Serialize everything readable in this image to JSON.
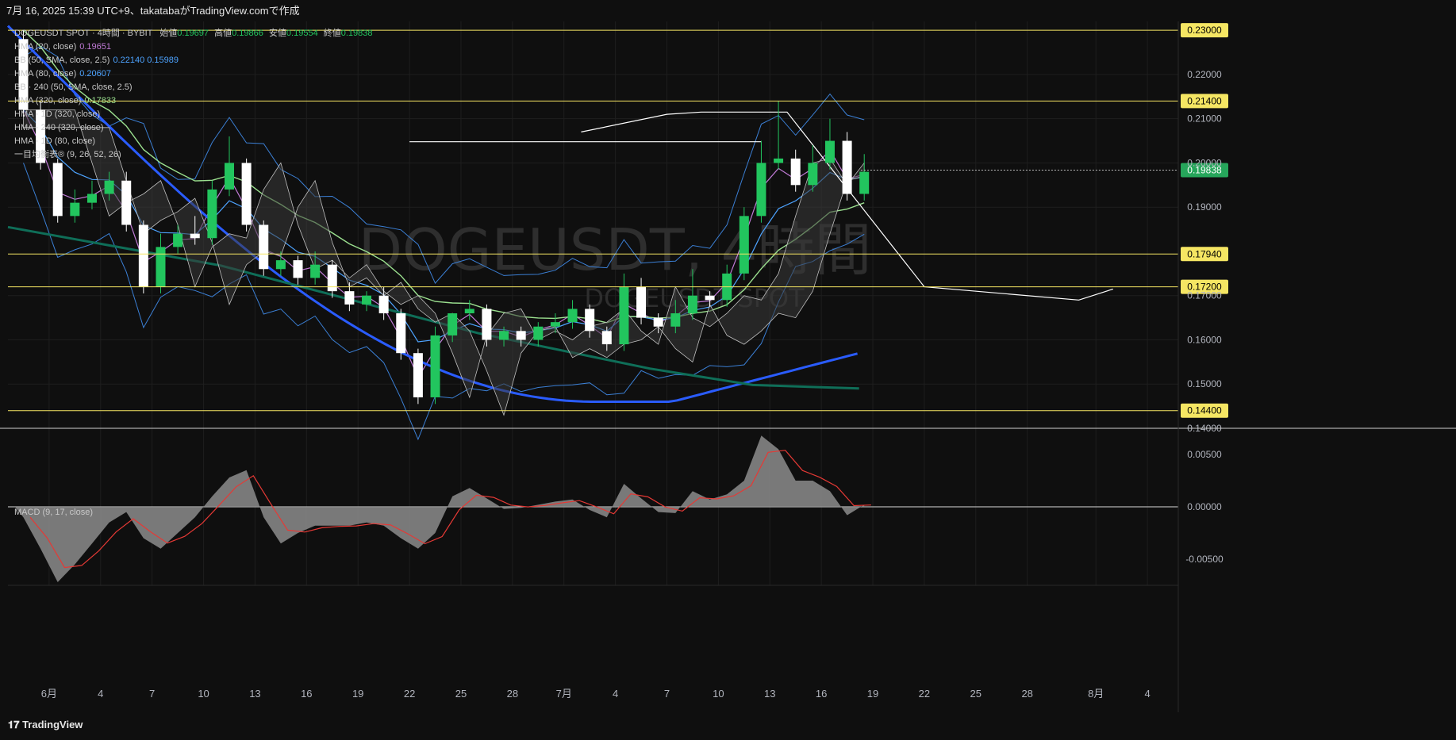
{
  "header": {
    "caption": "7月 16, 2025 15:39 UTC+9、takatabaがTradingView.comで作成"
  },
  "brand": {
    "logo_text": "TradingView"
  },
  "legend": {
    "main": {
      "symbol": "DOGEUSDT SPOT · 4時間 · BYBIT",
      "open_label": "始値",
      "open": "0.19697",
      "high_label": "高値",
      "high": "0.19866",
      "low_label": "安値",
      "low": "0.19554",
      "close_label": "終値",
      "close": "0.19838"
    },
    "rows": [
      {
        "label": "HMA (20, close)",
        "value": "0.19651",
        "color": "#c07ad6"
      },
      {
        "label": "BB (50, SMA, close, 2.5)",
        "value": "0.22140  0.15989",
        "color": "#4da3ff"
      },
      {
        "label": "HMA (80, close)",
        "value": "0.20607",
        "color": "#4da3ff"
      },
      {
        "label": "BB · 240 (50, SMA, close, 2.5)",
        "value": "",
        "color": "#c8c8c8"
      },
      {
        "label": "HMA (320, close)",
        "value": "0.17833",
        "color": "#9be08f"
      },
      {
        "label": "HMA · 1D (320, close)",
        "value": "",
        "color": "#c8c8c8"
      },
      {
        "label": "HMA · 240 (320, close)",
        "value": "",
        "color": "#c8c8c8"
      },
      {
        "label": "HMA · 1D (80, close)",
        "value": "",
        "color": "#c8c8c8"
      },
      {
        "label": "一目均衡表® (9, 26, 52, 26)",
        "value": "",
        "color": "#c8c8c8"
      }
    ]
  },
  "watermark": {
    "title": "DOGEUSDT, 4時間",
    "subtitle": "DOGEUSDT SPOT"
  },
  "macd": {
    "label": "MACD (9, 17, close)"
  },
  "colors": {
    "background": "#0f0f0f",
    "grid": "#1e1e1e",
    "up": "#22c55e",
    "down": "#ffffff",
    "hline": "#f5e663",
    "price_tag": "#f5e663",
    "last_price_tag": "#26a65b",
    "hma20": "#c07ad6",
    "hma80": "#4da3ff",
    "hma320": "#9be08f",
    "hma1d": "#2a5cff",
    "hma240_320": "#0f6e58",
    "bb": "#3b7fd4",
    "macd_hist": "#8c8c8c",
    "macd_signal": "#e53935"
  },
  "chart_data": [
    {
      "type": "candlestick",
      "title": "DOGEUSDT, 4時間",
      "ylim": [
        0.14,
        0.232
      ],
      "y_tick_labels": [
        "0.22000",
        "0.21000",
        "0.20000",
        "0.19000",
        "0.17000",
        "0.16000",
        "0.15000",
        "0.14000"
      ],
      "y_ticks": [
        0.22,
        0.21,
        0.2,
        0.19,
        0.17,
        0.16,
        0.15,
        0.14
      ],
      "horizontal_levels": [
        {
          "value": 0.23,
          "label": "0.23000"
        },
        {
          "value": 0.214,
          "label": "0.21400"
        },
        {
          "value": 0.1794,
          "label": "0.17940"
        },
        {
          "value": 0.172,
          "label": "0.17200"
        },
        {
          "value": 0.144,
          "label": "0.14400"
        }
      ],
      "last_price": {
        "value": 0.19838,
        "label": "0.19838"
      },
      "x_tick_labels": [
        "6月",
        "4",
        "7",
        "10",
        "13",
        "16",
        "19",
        "22",
        "25",
        "28",
        "7月",
        "4",
        "7",
        "10",
        "13",
        "16",
        "19",
        "22",
        "25",
        "28",
        "8月",
        "4"
      ],
      "x_days": [
        0,
        3,
        6,
        9,
        12,
        15,
        18,
        21,
        24,
        27,
        30,
        33,
        36,
        39,
        42,
        45,
        48,
        51,
        54,
        57,
        61,
        64
      ],
      "x_domain_days": [
        -2.4,
        65.8
      ],
      "candles_daily_approx": [
        {
          "day": -2,
          "o": 0.228,
          "h": 0.23,
          "c": 0.212
        },
        {
          "day": -1,
          "o": 0.212,
          "h": 0.214,
          "c": 0.2
        },
        {
          "day": 0,
          "o": 0.2,
          "h": 0.201,
          "c": 0.188
        },
        {
          "day": 1,
          "o": 0.188,
          "h": 0.194,
          "c": 0.191
        },
        {
          "day": 2,
          "o": 0.191,
          "h": 0.196,
          "c": 0.193
        },
        {
          "day": 3,
          "o": 0.193,
          "h": 0.198,
          "c": 0.196
        },
        {
          "day": 4,
          "o": 0.196,
          "h": 0.198,
          "c": 0.186
        },
        {
          "day": 5,
          "o": 0.186,
          "h": 0.187,
          "c": 0.172
        },
        {
          "day": 6,
          "o": 0.172,
          "h": 0.184,
          "c": 0.181
        },
        {
          "day": 7,
          "o": 0.181,
          "h": 0.186,
          "c": 0.184
        },
        {
          "day": 8,
          "o": 0.184,
          "h": 0.188,
          "c": 0.183
        },
        {
          "day": 9,
          "o": 0.183,
          "h": 0.196,
          "c": 0.194
        },
        {
          "day": 10,
          "o": 0.194,
          "h": 0.206,
          "c": 0.2
        },
        {
          "day": 11,
          "o": 0.2,
          "h": 0.201,
          "c": 0.186
        },
        {
          "day": 12,
          "o": 0.186,
          "h": 0.187,
          "c": 0.176
        },
        {
          "day": 13,
          "o": 0.176,
          "h": 0.18,
          "c": 0.178
        },
        {
          "day": 14,
          "o": 0.178,
          "h": 0.179,
          "c": 0.174
        },
        {
          "day": 15,
          "o": 0.174,
          "h": 0.18,
          "c": 0.177
        },
        {
          "day": 16,
          "o": 0.177,
          "h": 0.178,
          "c": 0.171
        },
        {
          "day": 17,
          "o": 0.171,
          "h": 0.173,
          "c": 0.168
        },
        {
          "day": 18,
          "o": 0.168,
          "h": 0.171,
          "c": 0.17
        },
        {
          "day": 19,
          "o": 0.17,
          "h": 0.172,
          "c": 0.166
        },
        {
          "day": 20,
          "o": 0.166,
          "h": 0.167,
          "c": 0.157
        },
        {
          "day": 21,
          "o": 0.157,
          "h": 0.158,
          "c": 0.147
        },
        {
          "day": 22,
          "o": 0.147,
          "h": 0.163,
          "c": 0.161
        },
        {
          "day": 23,
          "o": 0.161,
          "h": 0.166,
          "c": 0.166
        },
        {
          "day": 24,
          "o": 0.166,
          "h": 0.169,
          "c": 0.167
        },
        {
          "day": 25,
          "o": 0.167,
          "h": 0.168,
          "c": 0.16
        },
        {
          "day": 26,
          "o": 0.16,
          "h": 0.163,
          "c": 0.162
        },
        {
          "day": 27,
          "o": 0.162,
          "h": 0.163,
          "c": 0.16
        },
        {
          "day": 28,
          "o": 0.16,
          "h": 0.164,
          "c": 0.163
        },
        {
          "day": 29,
          "o": 0.163,
          "h": 0.166,
          "c": 0.164
        },
        {
          "day": 30,
          "o": 0.164,
          "h": 0.169,
          "c": 0.167
        },
        {
          "day": 31,
          "o": 0.167,
          "h": 0.168,
          "c": 0.162
        },
        {
          "day": 32,
          "o": 0.162,
          "h": 0.163,
          "c": 0.159
        },
        {
          "day": 33,
          "o": 0.159,
          "h": 0.175,
          "c": 0.172
        },
        {
          "day": 34,
          "o": 0.172,
          "h": 0.174,
          "c": 0.165
        },
        {
          "day": 35,
          "o": 0.165,
          "h": 0.166,
          "c": 0.163
        },
        {
          "day": 36,
          "o": 0.163,
          "h": 0.169,
          "c": 0.166
        },
        {
          "day": 37,
          "o": 0.166,
          "h": 0.176,
          "c": 0.17
        },
        {
          "day": 38,
          "o": 0.17,
          "h": 0.171,
          "c": 0.169
        },
        {
          "day": 39,
          "o": 0.169,
          "h": 0.177,
          "c": 0.175
        },
        {
          "day": 40,
          "o": 0.175,
          "h": 0.19,
          "c": 0.188
        },
        {
          "day": 41,
          "o": 0.188,
          "h": 0.205,
          "c": 0.2
        },
        {
          "day": 42,
          "o": 0.2,
          "h": 0.214,
          "c": 0.201
        },
        {
          "day": 43,
          "o": 0.201,
          "h": 0.203,
          "c": 0.195
        },
        {
          "day": 44,
          "o": 0.195,
          "h": 0.204,
          "c": 0.2
        },
        {
          "day": 45,
          "o": 0.2,
          "h": 0.21,
          "c": 0.205
        },
        {
          "day": 46,
          "o": 0.205,
          "h": 0.207,
          "c": 0.193
        },
        {
          "day": 47,
          "o": 0.193,
          "h": 0.202,
          "c": 0.198
        }
      ]
    },
    {
      "type": "macd",
      "title": "MACD (9, 17, close)",
      "ylim": [
        -0.0075,
        0.0075
      ],
      "y_tick_labels": [
        "0.00500",
        "0.00000",
        "-0.00500"
      ],
      "y_ticks": [
        0.005,
        0.0,
        -0.005
      ],
      "histogram_daily_approx": [
        {
          "day": -2,
          "v": -0.001
        },
        {
          "day": -1,
          "v": -0.004
        },
        {
          "day": 0,
          "v": -0.0072
        },
        {
          "day": 1,
          "v": -0.0055
        },
        {
          "day": 2,
          "v": -0.0035
        },
        {
          "day": 3,
          "v": -0.0015
        },
        {
          "day": 4,
          "v": -0.0005
        },
        {
          "day": 5,
          "v": -0.003
        },
        {
          "day": 6,
          "v": -0.004
        },
        {
          "day": 7,
          "v": -0.0025
        },
        {
          "day": 8,
          "v": -0.001
        },
        {
          "day": 9,
          "v": 0.001
        },
        {
          "day": 10,
          "v": 0.0028
        },
        {
          "day": 11,
          "v": 0.0035
        },
        {
          "day": 12,
          "v": -0.001
        },
        {
          "day": 13,
          "v": -0.0035
        },
        {
          "day": 14,
          "v": -0.0025
        },
        {
          "day": 15,
          "v": -0.0018
        },
        {
          "day": 16,
          "v": -0.0018
        },
        {
          "day": 17,
          "v": -0.0018
        },
        {
          "day": 18,
          "v": -0.0015
        },
        {
          "day": 19,
          "v": -0.0018
        },
        {
          "day": 20,
          "v": -0.003
        },
        {
          "day": 21,
          "v": -0.004
        },
        {
          "day": 22,
          "v": -0.0025
        },
        {
          "day": 23,
          "v": 0.001
        },
        {
          "day": 24,
          "v": 0.0018
        },
        {
          "day": 25,
          "v": 0.0008
        },
        {
          "day": 26,
          "v": -0.0002
        },
        {
          "day": 27,
          "v": -0.0001
        },
        {
          "day": 28,
          "v": 0.0002
        },
        {
          "day": 29,
          "v": 0.0005
        },
        {
          "day": 30,
          "v": 0.0007
        },
        {
          "day": 31,
          "v": -0.0003
        },
        {
          "day": 32,
          "v": -0.001
        },
        {
          "day": 33,
          "v": 0.0022
        },
        {
          "day": 34,
          "v": 0.0008
        },
        {
          "day": 35,
          "v": -0.0005
        },
        {
          "day": 36,
          "v": -0.0006
        },
        {
          "day": 37,
          "v": 0.0015
        },
        {
          "day": 38,
          "v": 0.0007
        },
        {
          "day": 39,
          "v": 0.0012
        },
        {
          "day": 40,
          "v": 0.0025
        },
        {
          "day": 41,
          "v": 0.0068
        },
        {
          "day": 42,
          "v": 0.0055
        },
        {
          "day": 43,
          "v": 0.0025
        },
        {
          "day": 44,
          "v": 0.0025
        },
        {
          "day": 45,
          "v": 0.0015
        },
        {
          "day": 46,
          "v": -0.0008
        },
        {
          "day": 47,
          "v": 0.0002
        }
      ]
    }
  ]
}
